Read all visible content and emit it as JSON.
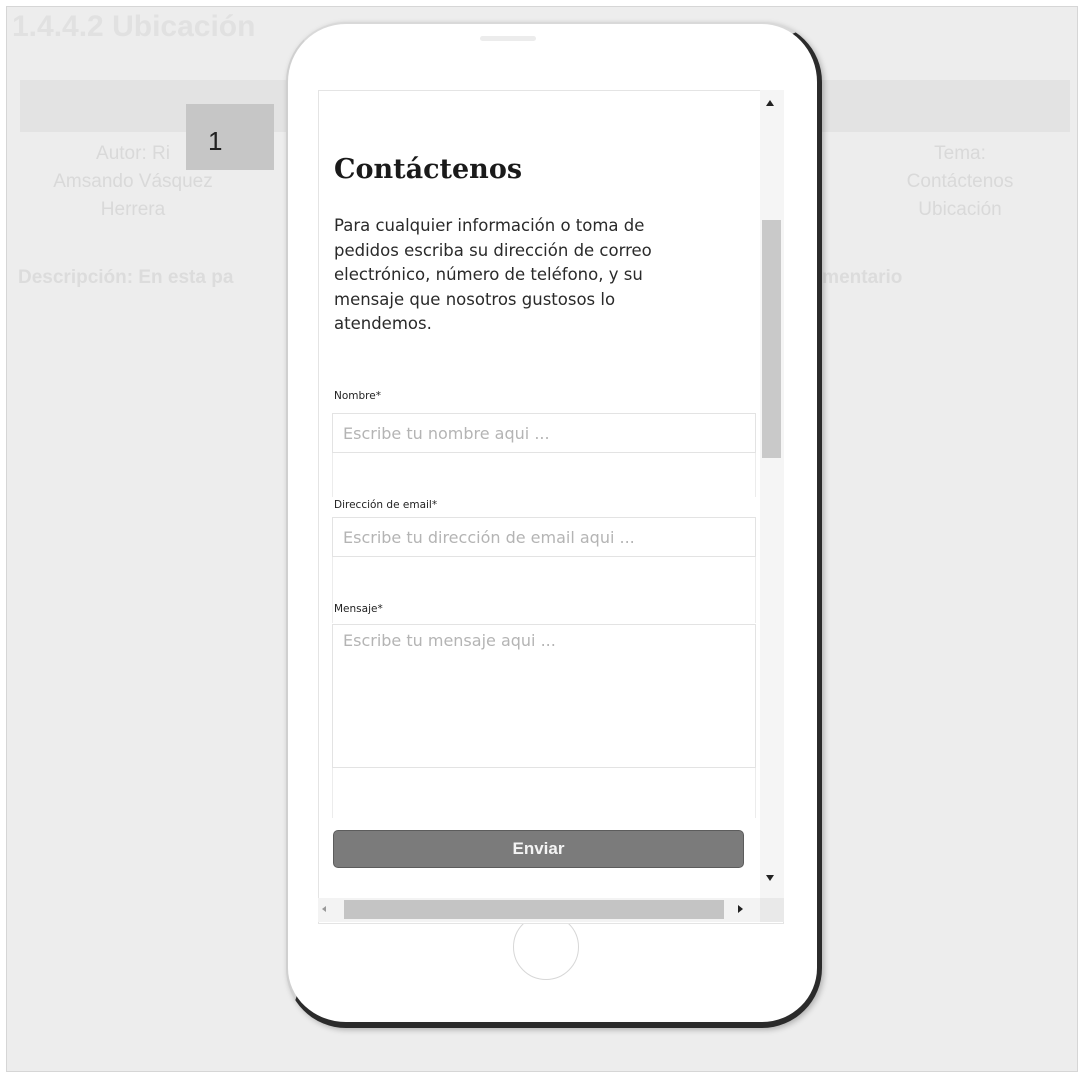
{
  "background_document": {
    "heading": "1.4.4.2 Ubicación",
    "author_lines": [
      "Autor: Ri",
      "Amsando Vásquez",
      "Herrera"
    ],
    "right_column_lines": [
      "Tema:",
      "Contáctenos",
      "Ubicación"
    ],
    "description": "Descripción: En esta pa",
    "description_tail": "comentario"
  },
  "step_badge": "1",
  "contact_page": {
    "title": "Contáctenos",
    "intro": "Para cualquier información o toma de pedidos escriba su dirección de correo electrónico, número de teléfono, y su mensaje que nosotros gustosos lo atendemos.",
    "fields": {
      "name": {
        "label": "Nombre*",
        "placeholder": "Escribe tu nombre aqui ..."
      },
      "email": {
        "label": "Dirección de email*",
        "placeholder": "Escribe tu dirección de email aqui ..."
      },
      "message": {
        "label": "Mensaje*",
        "placeholder": "Escribe tu mensaje aqui ..."
      }
    },
    "submit_label": "Enviar"
  }
}
